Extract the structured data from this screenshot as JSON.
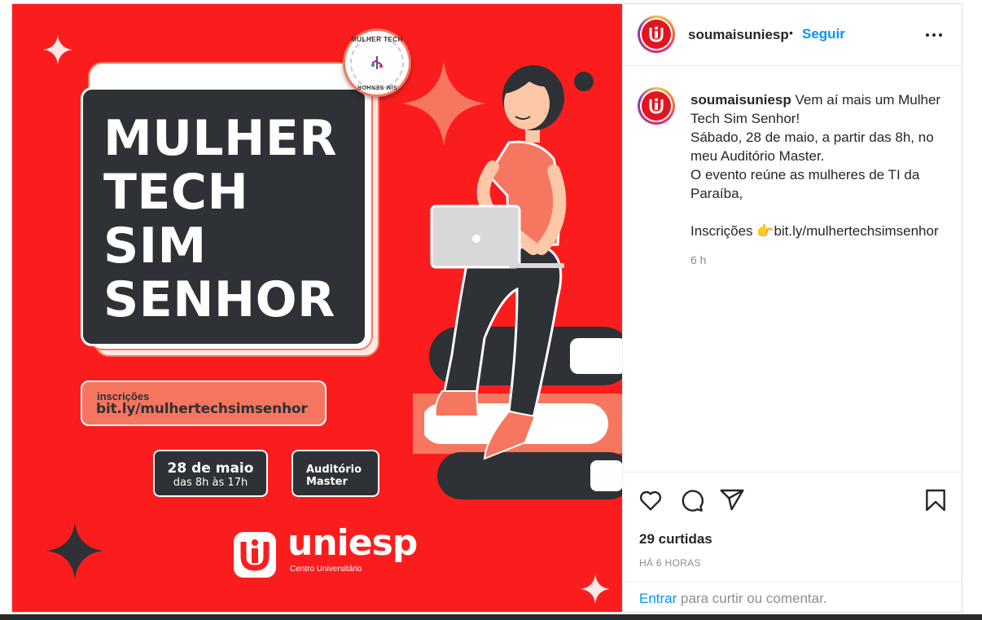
{
  "post_image": {
    "headline": [
      "MULHER",
      "TECH",
      "SIM",
      "SENHOR"
    ],
    "badge_top": "MULHER TECH",
    "badge_bottom": "SIM SENHOR",
    "signup_label": "inscrições",
    "signup_link": "bit.ly/mulhertechsimsenhor",
    "date_main": "28 de maio",
    "date_hours": "das 8h às 17h",
    "venue_line1": "Auditório",
    "venue_line2": "Master",
    "logo_name": "uniesp",
    "logo_sub": "Centro Universitário",
    "colors": {
      "background": "#fb1d1d",
      "card": "#2e3135",
      "salmon": "#f7765f"
    }
  },
  "header": {
    "username": "soumaisuniesp",
    "separator": "•",
    "follow_label": "Seguir"
  },
  "caption": {
    "username": "soumaisuniesp",
    "lines": [
      "Vem aí mais um Mulher",
      "Tech Sim Senhor!",
      "Sábado, 28 de maio, a partir das 8h, no",
      "meu Auditório Master.",
      "O evento reúne as mulheres de TI da",
      "Paraíba,",
      "",
      "Inscrições",
      "bit.ly/mulhertechsimsenhor"
    ],
    "pointing_emoji": "👉",
    "time": "6 h"
  },
  "actions": {
    "icons": [
      "heart-icon",
      "comment-icon",
      "share-icon",
      "bookmark-icon"
    ],
    "likes": "29 curtidas",
    "ago": "HÁ 6 HORAS",
    "login_link": "Entrar",
    "login_rest": "para curtir ou comentar."
  }
}
